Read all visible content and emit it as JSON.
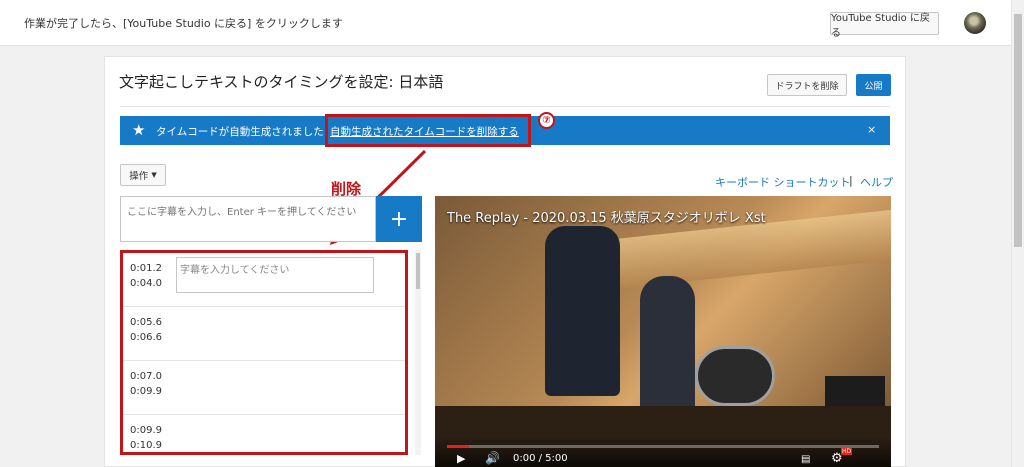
{
  "topbar": {
    "message": "作業が完了したら、[YouTube Studio に戻る] をクリックします",
    "back_button": "YouTube Studio に戻る"
  },
  "header": {
    "title": "文字起こしテキストのタイミングを設定: 日本語",
    "draft_delete": "ドラフトを削除",
    "publish": "公開"
  },
  "banner": {
    "star": "★",
    "text": "タイムコードが自動生成されました",
    "link": "自動生成されたタイムコードを削除する",
    "close": "×"
  },
  "annotations": {
    "step_number": "⑦",
    "delete_label": "削除"
  },
  "toolbar": {
    "operations": "操作",
    "keyboard_shortcuts": "キーボード ショートカット",
    "separator": "|",
    "help": "ヘルプ"
  },
  "caption_input": {
    "placeholder": "ここに字幕を入力し、Enter キーを押してください",
    "add": "+"
  },
  "captions": [
    {
      "start": "0:01.2",
      "end": "0:04.0",
      "placeholder": "字幕を入力してください"
    },
    {
      "start": "0:05.6",
      "end": "0:06.6"
    },
    {
      "start": "0:07.0",
      "end": "0:09.9"
    },
    {
      "start": "0:09.9",
      "end": "0:10.9"
    }
  ],
  "video": {
    "title": "The Replay - 2020.03.15 秋葉原スタジオリボレ Xst",
    "time": "0:00 / 5:00",
    "progress": 0.05
  },
  "colors": {
    "accent": "#167ac6",
    "highlight": "#c0161b"
  }
}
